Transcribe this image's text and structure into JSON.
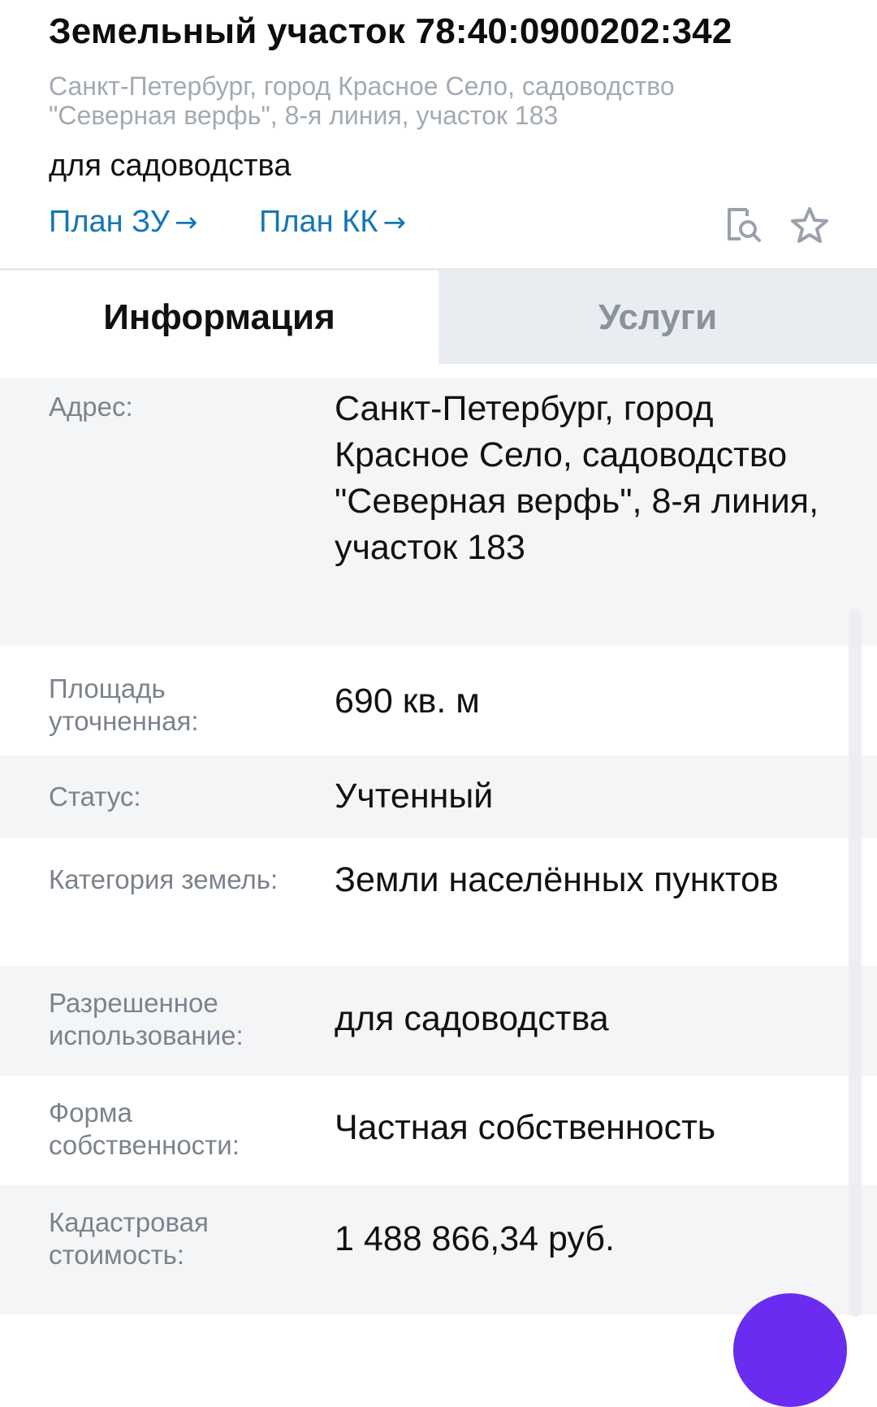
{
  "header": {
    "title": "Земельный участок 78:40:0900202:342",
    "address_line": "Санкт-Петербург, город Красное Село, садоводство \"Северная верфь\", 8-я линия, участок 183",
    "purpose": "для садоводства",
    "links": [
      {
        "label": "План ЗУ",
        "arrow": "→"
      },
      {
        "label": "План КК",
        "arrow": "→"
      }
    ],
    "icons": [
      "document-search-icon",
      "star-icon"
    ]
  },
  "tabs": [
    {
      "label": "Информация",
      "active": true
    },
    {
      "label": "Услуги",
      "active": false
    }
  ],
  "details": [
    {
      "label": "Адрес:",
      "value": "Санкт-Петербург, город Красное Село, садоводство \"Северная верфь\", 8-я линия, участок 183"
    },
    {
      "label": "Площадь уточненная:",
      "value": "690 кв. м"
    },
    {
      "label": "Статус:",
      "value": "Учтенный"
    },
    {
      "label": "Категория земель:",
      "value": "Земли населённых пунктов"
    },
    {
      "label": "Разрешенное использование:",
      "value": "для садоводства"
    },
    {
      "label": "Форма собственности:",
      "value": "Частная собственность"
    },
    {
      "label": "Кадастровая стоимость:",
      "value": "1 488 866,34 руб."
    }
  ],
  "colors": {
    "link": "#1476b8",
    "muted_text": "#a3aab3",
    "label_text": "#7b838c",
    "inactive_tab_bg": "#e9ecf1",
    "row_shade": "#f4f5f7",
    "fab": "#6a2cf0"
  }
}
